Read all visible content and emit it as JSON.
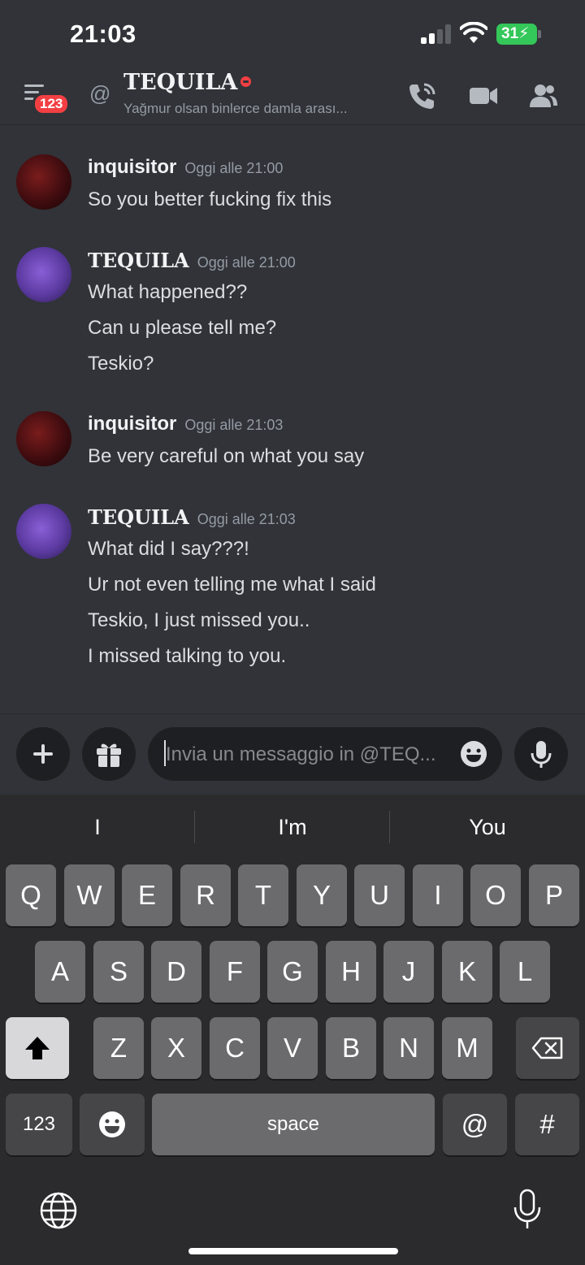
{
  "status_bar": {
    "time": "21:03",
    "battery": "31"
  },
  "header": {
    "unread_badge": "123",
    "channel_name": "TEQUILA",
    "channel_status": "Yağmur olsan binlerce damla arası...",
    "icons": [
      "menu-icon",
      "at-icon",
      "call-icon",
      "video-icon",
      "members-icon"
    ]
  },
  "messages": [
    {
      "author": "inquisitor",
      "timestamp": "Oggi alle 21:00",
      "lines": [
        "So you better fucking fix this"
      ]
    },
    {
      "author": "TEQUILA",
      "timestamp": "Oggi alle 21:00",
      "lines": [
        "What happened??",
        "Can u please tell me?",
        "Teskio?"
      ]
    },
    {
      "author": "inquisitor",
      "timestamp": "Oggi alle 21:03",
      "lines": [
        "Be very careful on what you say"
      ]
    },
    {
      "author": "TEQUILA",
      "timestamp": "Oggi alle 21:03",
      "lines": [
        "What did I say???!",
        "Ur not even telling me what I said",
        "Teskio, I just missed you..",
        "I missed talking to you."
      ]
    }
  ],
  "composer": {
    "placeholder": "Invia un messaggio in @TEQ..."
  },
  "keyboard": {
    "suggestions": [
      "I",
      "I'm",
      "You"
    ],
    "row1": [
      "Q",
      "W",
      "E",
      "R",
      "T",
      "Y",
      "U",
      "I",
      "O",
      "P"
    ],
    "row2": [
      "A",
      "S",
      "D",
      "F",
      "G",
      "H",
      "J",
      "K",
      "L"
    ],
    "row3": [
      "Z",
      "X",
      "C",
      "V",
      "B",
      "N",
      "M"
    ],
    "numbers_key": "123",
    "space_key": "space",
    "at_key": "@",
    "hash_key": "#"
  },
  "colors": {
    "background": "#313338",
    "keyboard": "#2b2b2d",
    "dnd": "#f23f43",
    "battery": "#34c759"
  }
}
